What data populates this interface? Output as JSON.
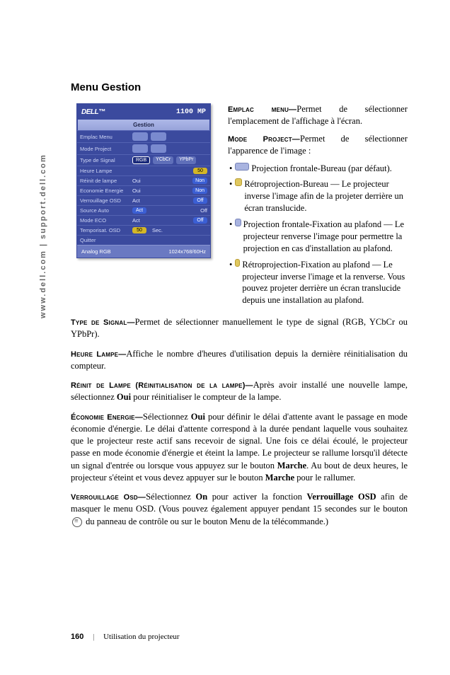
{
  "side_url": "www.dell.com | support.dell.com",
  "title": "Menu Gestion",
  "osd": {
    "logo": "DELL™",
    "model": "1100 MP",
    "tab": "Gestion",
    "rows": {
      "emplac": "Emplac Menu",
      "mode": "Mode Project",
      "signal": "Type de Signal",
      "signal_rgb": "RGB",
      "signal_ycbcr": "YCbCr",
      "signal_ypbpr": "YPbPr",
      "heure": "Heure Lampe",
      "heure_val": "50",
      "reinit": "Réinit de lampe",
      "oui": "Oui",
      "non": "Non",
      "eco_energie": "Economie Energie",
      "verrou": "Verrouillage OSD",
      "act": "Act",
      "off": "Off",
      "source": "Source Auto",
      "mode_eco": "Mode ECO",
      "temporisat": "Temporisat. OSD",
      "temporisat_val": "50",
      "sec": "Sec.",
      "quitter": "Quitter"
    },
    "foot_left": "Analog RGB",
    "foot_right": "1024x768/60Hz"
  },
  "right": {
    "p1a": "Emplac menu—",
    "p1b": "Permet de sélectionner l'emplacement de l'affichage à l'écran.",
    "p2a": "Mode Project—",
    "p2b": "Permet de sélectionner l'apparence de l'image :",
    "b1": "Projection frontale-Bureau (par défaut).",
    "b2": "Rétroprojection-Bureau — Le projecteur inverse l'image afin de la projeter derrière un écran translucide.",
    "b3": "Projection frontale-Fixation au plafond — Le projecteur renverse l'image pour permettre la projection en cas d'installation au plafond.",
    "b4": "Rétroprojection-Fixation au plafond — Le projecteur inverse l'image et la renverse. Vous pouvez projeter derrière un écran translucide depuis une installation au plafond."
  },
  "body": {
    "p3a": "Type de Signal—",
    "p3b": "Permet de sélectionner manuellement le type de signal (RGB, YCbCr ou YPbPr).",
    "p4a": "Heure Lampe—",
    "p4b": "Affiche le nombre d'heures d'utilisation depuis la dernière réinitialisation du compteur.",
    "p5a": "Réinit de Lampe (Réinitialisation de la lampe)—",
    "p5b1": "Après avoir installé une nouvelle lampe, sélectionnez ",
    "p5b2": "Oui",
    "p5b3": " pour réinitialiser le compteur de la lampe.",
    "p6a": "Économie Energie—",
    "p6b1": "Sélectionnez ",
    "p6b2": "Oui",
    "p6b3": " pour définir le délai d'attente avant le passage en mode économie d'énergie. Le délai d'attente correspond à la durée pendant laquelle vous souhaitez que le projecteur reste actif sans recevoir de signal. Une fois ce délai écoulé, le projecteur passe en mode économie d'énergie et éteint la lampe. Le projecteur se rallume lorsqu'il détecte un signal d'entrée ou lorsque vous appuyez sur le bouton ",
    "p6b4": "Marche",
    "p6b5": ". Au bout de deux heures, le projecteur s'éteint et vous devez appuyer sur le bouton ",
    "p6b6": "Marche",
    "p6b7": " pour le rallumer.",
    "p7a": "Verrouillage Osd—",
    "p7b1": "Sélectionnez ",
    "p7b2": "On",
    "p7b3": " pour activer la fonction ",
    "p7b4": "Verrouillage OSD",
    "p7b5": " afin de masquer le menu OSD. (Vous pouvez également appuyer pendant 15 secondes sur le bouton ",
    "p7b6": " du panneau de contrôle ou sur le bouton Menu de la télécommande.)"
  },
  "footer": {
    "page": "160",
    "section": "Utilisation du projecteur"
  }
}
